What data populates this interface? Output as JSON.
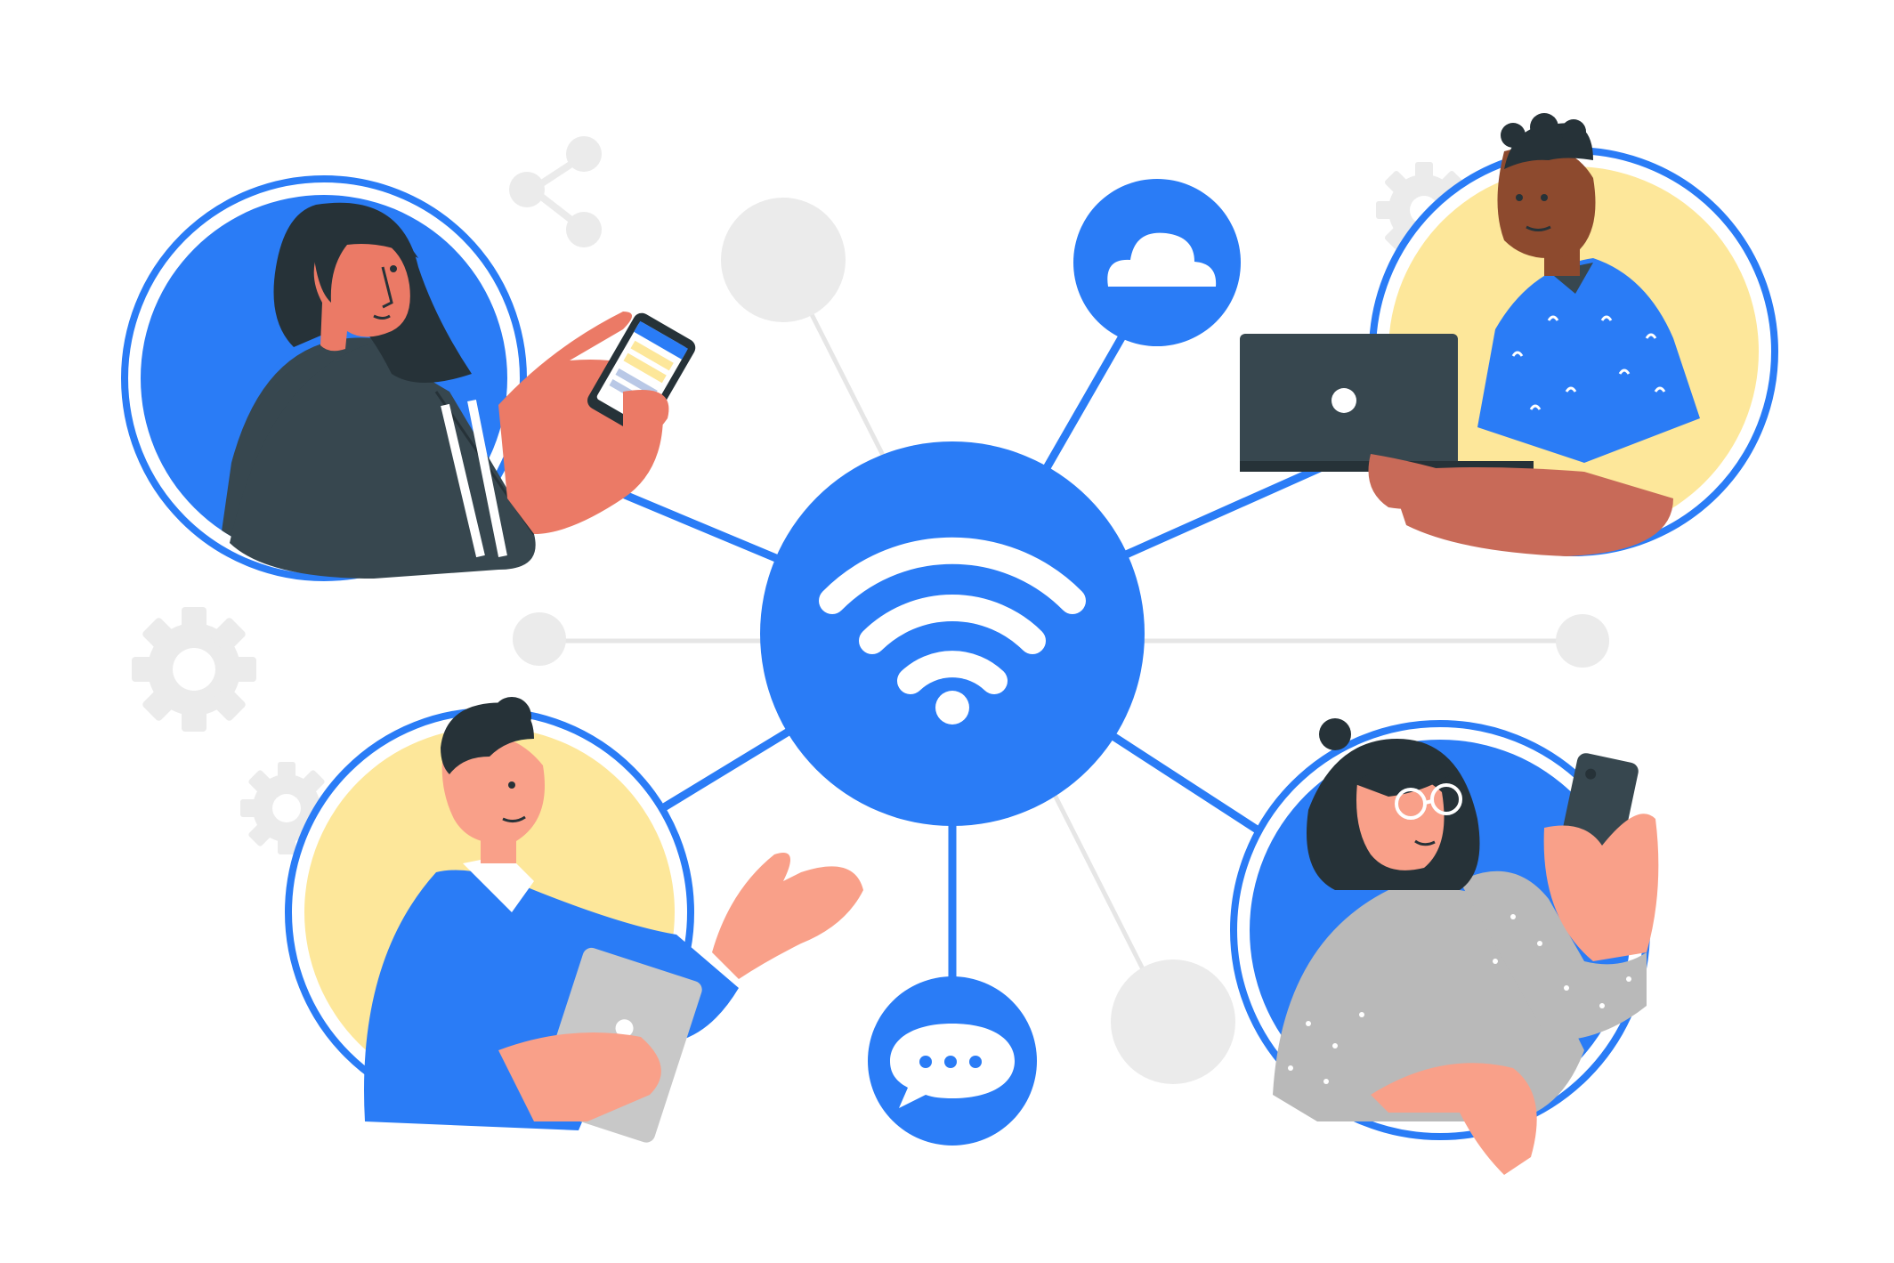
{
  "illustration": {
    "nodes": [
      {
        "name": "woman-with-phone",
        "role": "person"
      },
      {
        "name": "man-with-laptop",
        "role": "person"
      },
      {
        "name": "man-with-tablet",
        "role": "person"
      },
      {
        "name": "woman-with-glasses-phone",
        "role": "person"
      }
    ],
    "hub_icon": "wifi-icon",
    "satellite_icons": [
      "cloud-icon",
      "chat-bubble-icon"
    ],
    "background_icons": [
      "share-icon",
      "gear-icon"
    ]
  },
  "colors": {
    "primary_blue": "#2a7cf6",
    "light_gray": "#ebebeb",
    "yellow": "#fde79a",
    "skin_coral": "#eb7a66",
    "skin_peach": "#f9a089",
    "skin_dark": "#c86a58",
    "skin_brown": "#8d4a2e",
    "dark_slate": "#263238",
    "charcoal_teal": "#37474f",
    "outline_dark": "#1f2a30",
    "white": "#ffffff",
    "gray_shirt": "#b9b9b9",
    "tablet_gray": "#c8c8c8"
  }
}
